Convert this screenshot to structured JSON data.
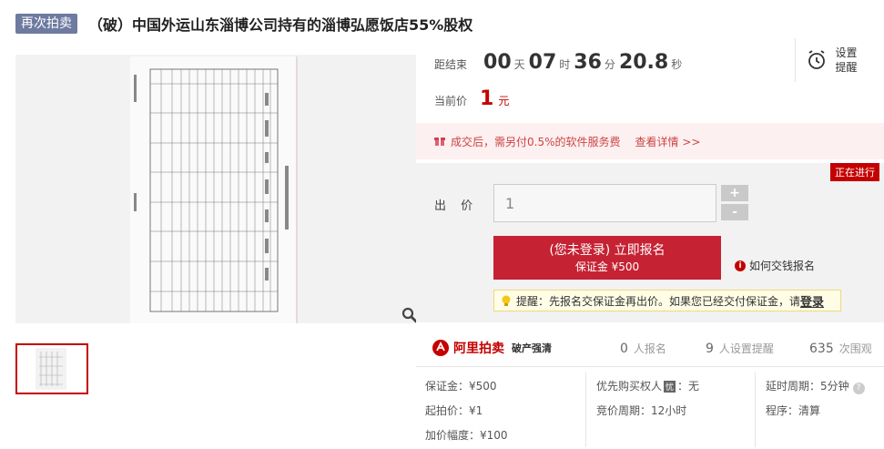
{
  "header": {
    "tag": "再次拍卖",
    "title": "（破）中国外运山东淄博公司持有的淄博弘愿饭店55%股权"
  },
  "countdown": {
    "label": "距结束",
    "days": "00",
    "days_unit": "天",
    "hours": "07",
    "hours_unit": "时",
    "minutes": "36",
    "minutes_unit": "分",
    "seconds": "20.8",
    "seconds_unit": "秒"
  },
  "current_price": {
    "label": "当前价",
    "value": "1",
    "unit": "元"
  },
  "reminder": {
    "line1": "设置",
    "line2": "提醒"
  },
  "notice": {
    "text": "成交后，需另付0.5%的软件服务费",
    "link": "查看详情 >>"
  },
  "bid": {
    "status": "正在进行",
    "label": "出 价",
    "input_value": "1",
    "plus": "+",
    "minus": "-",
    "register_line1": "(您未登录) 立即报名",
    "register_line2": "保证金 ¥500",
    "help_link": "如何交钱报名",
    "tip_text": "提醒：先报名交保证金再出价。如果您已经交付保证金，请",
    "tip_login": "登录"
  },
  "brand": {
    "name": "阿里拍卖",
    "sub": "破产强清",
    "signups": "0",
    "signups_label": "人报名",
    "reminders": "9",
    "reminders_label": "人设置提醒",
    "views": "635",
    "views_label": "次围观"
  },
  "details": {
    "deposit": "保证金：¥500",
    "start_price": "起拍价：¥1",
    "increment": "加价幅度：¥100",
    "priority_label": "优先购买权人",
    "priority_badge": "忧",
    "priority_value": "：无",
    "cycle": "竞价周期：12小时",
    "delay": "延时周期：5分钟",
    "procedure": "程序：清算"
  },
  "colors": {
    "accent": "#c40000",
    "button": "#c52233",
    "tag": "#6e7aa0"
  }
}
